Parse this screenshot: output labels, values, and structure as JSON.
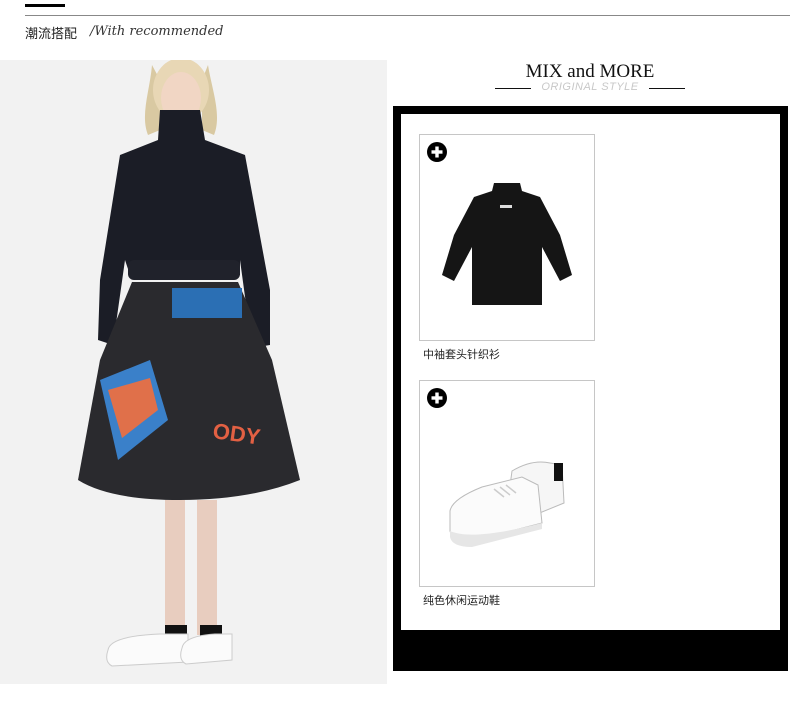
{
  "header": {
    "title": "潮流搭配",
    "subtitle": "/With recommended"
  },
  "mix": {
    "title": "MIX and MORE",
    "subtitle": "ORIGINAL STYLE"
  },
  "products": [
    {
      "name": "中袖套头针织衫",
      "icon": "plus-circle-icon"
    },
    {
      "name": "纯色休闲运动鞋",
      "icon": "plus-circle-icon"
    }
  ],
  "colors": {
    "panel": "#000000",
    "divider": "#888888",
    "subtitle_gray": "#c8c8c8"
  }
}
